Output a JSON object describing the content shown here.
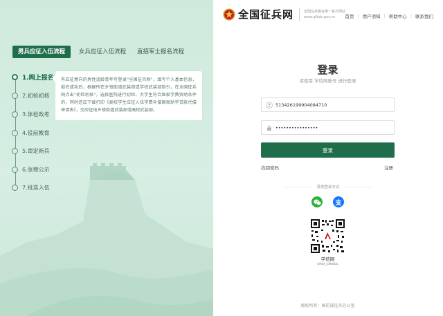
{
  "header": {
    "logo_text": "全国征兵网",
    "logo_sub_line1": "全国征兵报名唯一官方网站",
    "logo_sub_line2": "www.gfbzb.gov.cn",
    "nav": [
      "首页",
      "用户须知",
      "帮助中心",
      "联系我们"
    ]
  },
  "left": {
    "tabs": [
      "男兵应征入伍流程",
      "女兵应征入伍流程",
      "直招军士报名流程"
    ],
    "steps": [
      "1.网上报名",
      "2.初检初核",
      "3.体检政考",
      "4.役前教育",
      "5.审定新兵",
      "6.张榜公示",
      "7.批准入伍"
    ],
    "active_step_description": "有应征意向的男性适龄青年可登录\"全国征兵网\"，填写个人基本信息，报名成功后，根据所在乡镇街道武装部或学校武装部指引，在全国征兵网点击\"初检初核\"，选择医院进行初检。大学生符合国家学费资助条件的，同时还应下载打印《高校学生应征入伍学费补偿国家助学贷款代偿申请表》，交应征地乡镇街道武装部或高校武装部。"
  },
  "login": {
    "title": "登录",
    "subtitle": "请使用 学信网账号 进行登录",
    "username_value": "513426199904084710",
    "password_value": "••••••••••••••••",
    "login_button": "登录",
    "forgot_link": "找回密码",
    "register_link": "注册",
    "other_methods": "其他登录方式",
    "qr_name": "学信网",
    "qr_id": "chsi_chsicc",
    "copyright": "版权所有：国防部征兵办公室"
  },
  "colors": {
    "accent": "#1d6e49",
    "left_bg": "#d6eee3",
    "wechat": "#2db33a",
    "alipay": "#1677ff"
  },
  "icons": [
    "user-icon",
    "lock-icon",
    "wechat-icon",
    "alipay-icon",
    "emblem-icon"
  ]
}
